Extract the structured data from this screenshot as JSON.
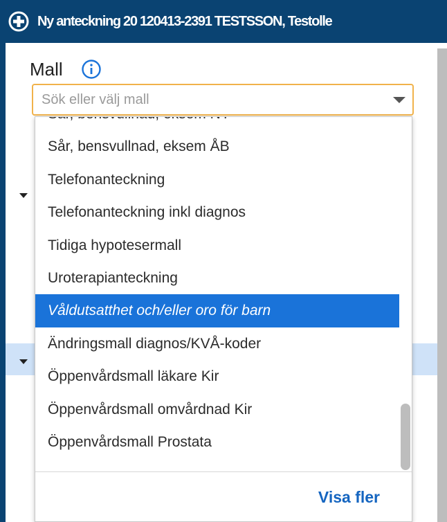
{
  "titlebar": {
    "title": "Ny anteckning 20 120413-2391 TESTSSON, Testolle",
    "icon": "plus-circle-icon"
  },
  "form": {
    "mall_label": "Mall",
    "info_icon": "info-circle-icon",
    "mall_placeholder": "Sök eller välj mall"
  },
  "dropdown": {
    "items": [
      "Sår, bensvullnad, eksem NY",
      "Sår, bensvullnad, eksem ÅB",
      "Telefonanteckning",
      "Telefonanteckning inkl diagnos",
      "Tidiga hypotesermall",
      "Uroterapianteckning",
      "Våldutsatthet och/eller oro för barn",
      "Ändringsmall diagnos/KVÅ-koder",
      "Öppenvårdsmall läkare Kir",
      "Öppenvårdsmall omvårdnad Kir",
      "Öppenvårdsmall Prostata"
    ],
    "selected_index": 6,
    "show_more_label": "Visa fler"
  },
  "colors": {
    "titlebar": "#0a4372",
    "selected": "#1a73d9",
    "input_focus_border": "#f1b24a",
    "link": "#1565c0"
  }
}
